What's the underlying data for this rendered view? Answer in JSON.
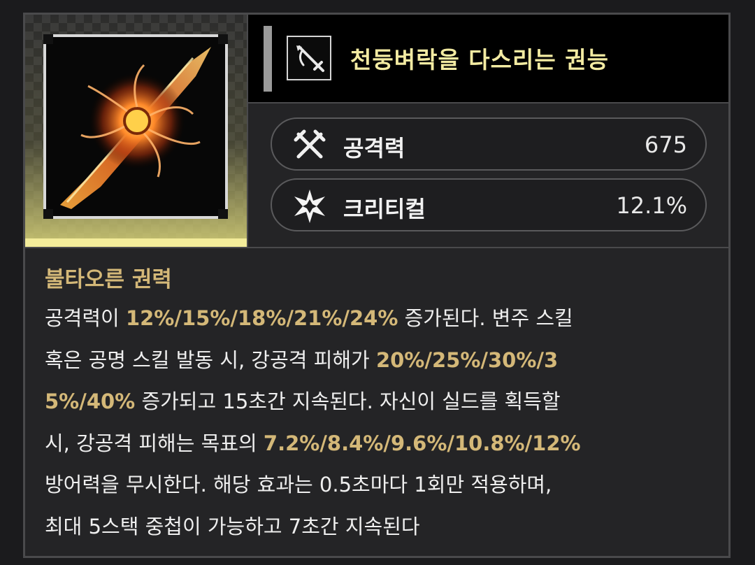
{
  "item": {
    "name": "천둥벼락을 다스리는 권능",
    "type_icon": "sword-icon"
  },
  "stats": [
    {
      "icon": "attack-icon",
      "label": "공격력",
      "value": "675"
    },
    {
      "icon": "critical-star-icon",
      "label": "크리티컬",
      "value": "12.1%"
    }
  ],
  "effect": {
    "title": "불타오른 권력",
    "lines": [
      {
        "pre": "공격력이 ",
        "hl": "12%/15%/18%/21%/24%",
        "post": " 증가된다. 변주 스킬"
      },
      {
        "pre": "혹은 공명 스킬 발동 시, 강공격 피해가 ",
        "hl": "20%/25%/30%/3",
        "post": ""
      },
      {
        "pre": "",
        "hl": "5%/40%",
        "post": " 증가되고 15초간 지속된다. 자신이 실드를 획득할"
      },
      {
        "pre": "시, 강공격 피해는 목표의 ",
        "hl": "7.2%/8.4%/9.6%/10.8%/12%",
        "post": ""
      },
      {
        "pre": "방어력을 무시한다. 해당 효과는 0.5초마다 1회만 적용하며,",
        "hl": "",
        "post": ""
      },
      {
        "pre": "최대 5스택 중첩이 가능하고 7초간 지속된다",
        "hl": "",
        "post": ""
      }
    ]
  },
  "colors": {
    "title": "#f3eba2",
    "highlight": "#d4b878",
    "rarity_bar": "#f3ec9a"
  }
}
